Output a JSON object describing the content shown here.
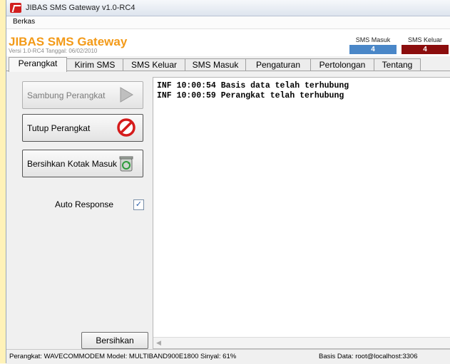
{
  "window": {
    "title": "JIBAS SMS Gateway v1.0-RC4"
  },
  "menu": {
    "items": [
      "Berkas"
    ]
  },
  "header": {
    "brand": "JIBAS SMS Gateway",
    "version": "Versi 1.0-RC4 Tanggal: 06/02/2010",
    "sms_masuk_label": "SMS Masuk",
    "sms_masuk_count": "4",
    "sms_keluar_label": "SMS Keluar",
    "sms_keluar_count": "4"
  },
  "tabs": [
    "Perangkat",
    "Kirim SMS",
    "SMS Keluar",
    "SMS Masuk",
    "Pengaturan",
    "Pertolongan",
    "Tentang"
  ],
  "left": {
    "connect_label": "Sambung Perangkat",
    "close_label": "Tutup Perangkat",
    "clear_inbox_label": "Bersihkan Kotak Masuk",
    "auto_response_label": "Auto Response",
    "auto_response_checked": "✓",
    "clear_label": "Bersihkan"
  },
  "log": [
    "INF 10:00:54 Basis data telah terhubung",
    "INF 10:00:59 Perangkat telah terhubung"
  ],
  "status": {
    "left": "Perangkat: WAVECOMMODEM  Model: MULTIBAND900E1800  Sinyal: 61%",
    "right": "Basis Data: root@localhost:3306"
  },
  "colors": {
    "brand": "#f39a18",
    "masuk": "#4a87c8",
    "keluar": "#8b0d0d"
  },
  "icons": {
    "connect": "play-arrow-icon",
    "close": "prohibited-icon",
    "clear_inbox": "recycle-bin-icon"
  }
}
